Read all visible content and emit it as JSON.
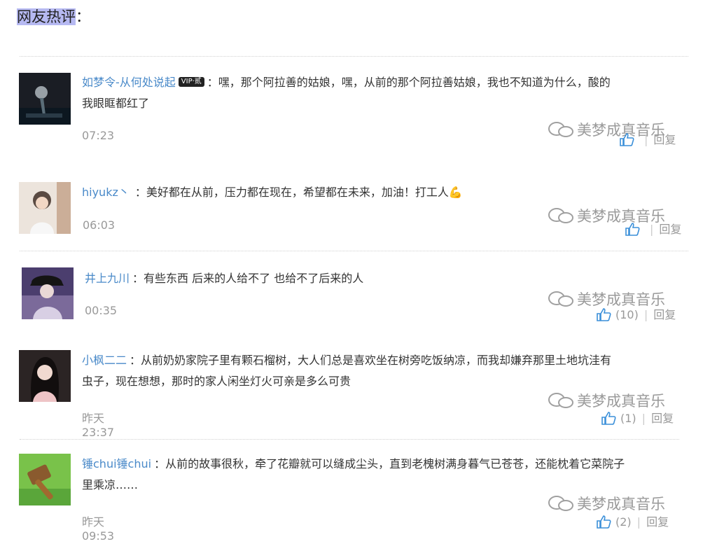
{
  "header": {
    "title": "网友热评",
    "colon": "："
  },
  "watermark": "美梦成真音乐",
  "separator": "：",
  "comments": [
    {
      "user": "如梦令-从何处说起",
      "badge": "VIP·贰",
      "text_lines": [
        "嘿，那个阿拉善的姑娘，嘿，从前的那个阿拉善姑娘，我也不知道为什么，酸的",
        "我眼眶都红了"
      ],
      "time": "07:23",
      "likes": "",
      "reply": "回复"
    },
    {
      "user": "hiyukz丶",
      "text_lines": [
        "美好都在从前，压力都在现在，希望都在未来，加油！打工人💪"
      ],
      "time": "06:03",
      "likes": "",
      "reply": "回复"
    },
    {
      "user": "井上九川",
      "text_lines": [
        "有些东西 后来的人给不了 也给不了后来的人"
      ],
      "time": "00:35",
      "likes": "(10)",
      "reply": "回复"
    },
    {
      "user": "小枫二二",
      "text_lines": [
        "从前奶奶家院子里有颗石榴树，大人们总是喜欢坐在树旁吃饭纳凉，而我却嫌弃那里土地坑洼有",
        "虫子，现在想想，那时的家人闲坐灯火可亲是多么可贵"
      ],
      "time": "昨天23:37",
      "likes": "(1)",
      "reply": "回复"
    },
    {
      "user": "锤chui锤chui",
      "text_lines": [
        "从前的故事很秋，牵了花瓣就可以缝成尘头，直到老槐树满身暮气已苍苍，还能枕着它菜院子",
        "里乘凉……"
      ],
      "time": "昨天09:53",
      "likes": "(2)",
      "reply": "回复"
    }
  ]
}
